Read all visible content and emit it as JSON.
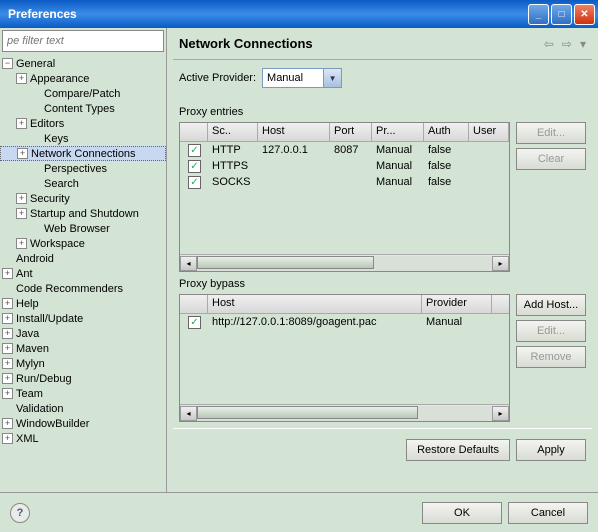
{
  "window": {
    "title": "Preferences"
  },
  "filter": {
    "placeholder": "pe filter text"
  },
  "tree": [
    {
      "label": "General",
      "lvl": 0,
      "exp": "−"
    },
    {
      "label": "Appearance",
      "lvl": 1,
      "exp": "+"
    },
    {
      "label": "Compare/Patch",
      "lvl": 2,
      "exp": ""
    },
    {
      "label": "Content Types",
      "lvl": 2,
      "exp": ""
    },
    {
      "label": "Editors",
      "lvl": 1,
      "exp": "+"
    },
    {
      "label": "Keys",
      "lvl": 2,
      "exp": ""
    },
    {
      "label": "Network Connections",
      "lvl": 1,
      "exp": "+",
      "sel": true
    },
    {
      "label": "Perspectives",
      "lvl": 2,
      "exp": ""
    },
    {
      "label": "Search",
      "lvl": 2,
      "exp": ""
    },
    {
      "label": "Security",
      "lvl": 1,
      "exp": "+"
    },
    {
      "label": "Startup and Shutdown",
      "lvl": 1,
      "exp": "+"
    },
    {
      "label": "Web Browser",
      "lvl": 2,
      "exp": ""
    },
    {
      "label": "Workspace",
      "lvl": 1,
      "exp": "+"
    },
    {
      "label": "Android",
      "lvl": 0,
      "exp": ""
    },
    {
      "label": "Ant",
      "lvl": 0,
      "exp": "+"
    },
    {
      "label": "Code Recommenders",
      "lvl": 0,
      "exp": ""
    },
    {
      "label": "Help",
      "lvl": 0,
      "exp": "+"
    },
    {
      "label": "Install/Update",
      "lvl": 0,
      "exp": "+"
    },
    {
      "label": "Java",
      "lvl": 0,
      "exp": "+"
    },
    {
      "label": "Maven",
      "lvl": 0,
      "exp": "+"
    },
    {
      "label": "Mylyn",
      "lvl": 0,
      "exp": "+"
    },
    {
      "label": "Run/Debug",
      "lvl": 0,
      "exp": "+"
    },
    {
      "label": "Team",
      "lvl": 0,
      "exp": "+"
    },
    {
      "label": "Validation",
      "lvl": 0,
      "exp": ""
    },
    {
      "label": "WindowBuilder",
      "lvl": 0,
      "exp": "+"
    },
    {
      "label": "XML",
      "lvl": 0,
      "exp": "+"
    }
  ],
  "page": {
    "title": "Network Connections",
    "activeProviderLabel": "Active Provider:",
    "activeProviderValue": "Manual",
    "proxyEntries": {
      "label": "Proxy entries",
      "headers": [
        "Sc..",
        "Host",
        "Port",
        "Pr...",
        "Auth",
        "User"
      ],
      "rows": [
        {
          "checked": true,
          "scheme": "HTTP",
          "host": "127.0.0.1",
          "port": "8087",
          "prov": "Manual",
          "auth": "false",
          "user": ""
        },
        {
          "checked": true,
          "scheme": "HTTPS",
          "host": "",
          "port": "",
          "prov": "Manual",
          "auth": "false",
          "user": ""
        },
        {
          "checked": true,
          "scheme": "SOCKS",
          "host": "",
          "port": "",
          "prov": "Manual",
          "auth": "false",
          "user": ""
        }
      ],
      "buttons": {
        "edit": "Edit...",
        "clear": "Clear"
      }
    },
    "proxyBypass": {
      "label": "Proxy bypass",
      "headers": [
        "Host",
        "Provider"
      ],
      "rows": [
        {
          "checked": true,
          "host": "http://127.0.0.1:8089/goagent.pac",
          "prov": "Manual"
        }
      ],
      "buttons": {
        "add": "Add Host...",
        "edit": "Edit...",
        "remove": "Remove"
      }
    },
    "restoreDefaults": "Restore Defaults",
    "apply": "Apply"
  },
  "dialog": {
    "ok": "OK",
    "cancel": "Cancel",
    "help": "?"
  }
}
